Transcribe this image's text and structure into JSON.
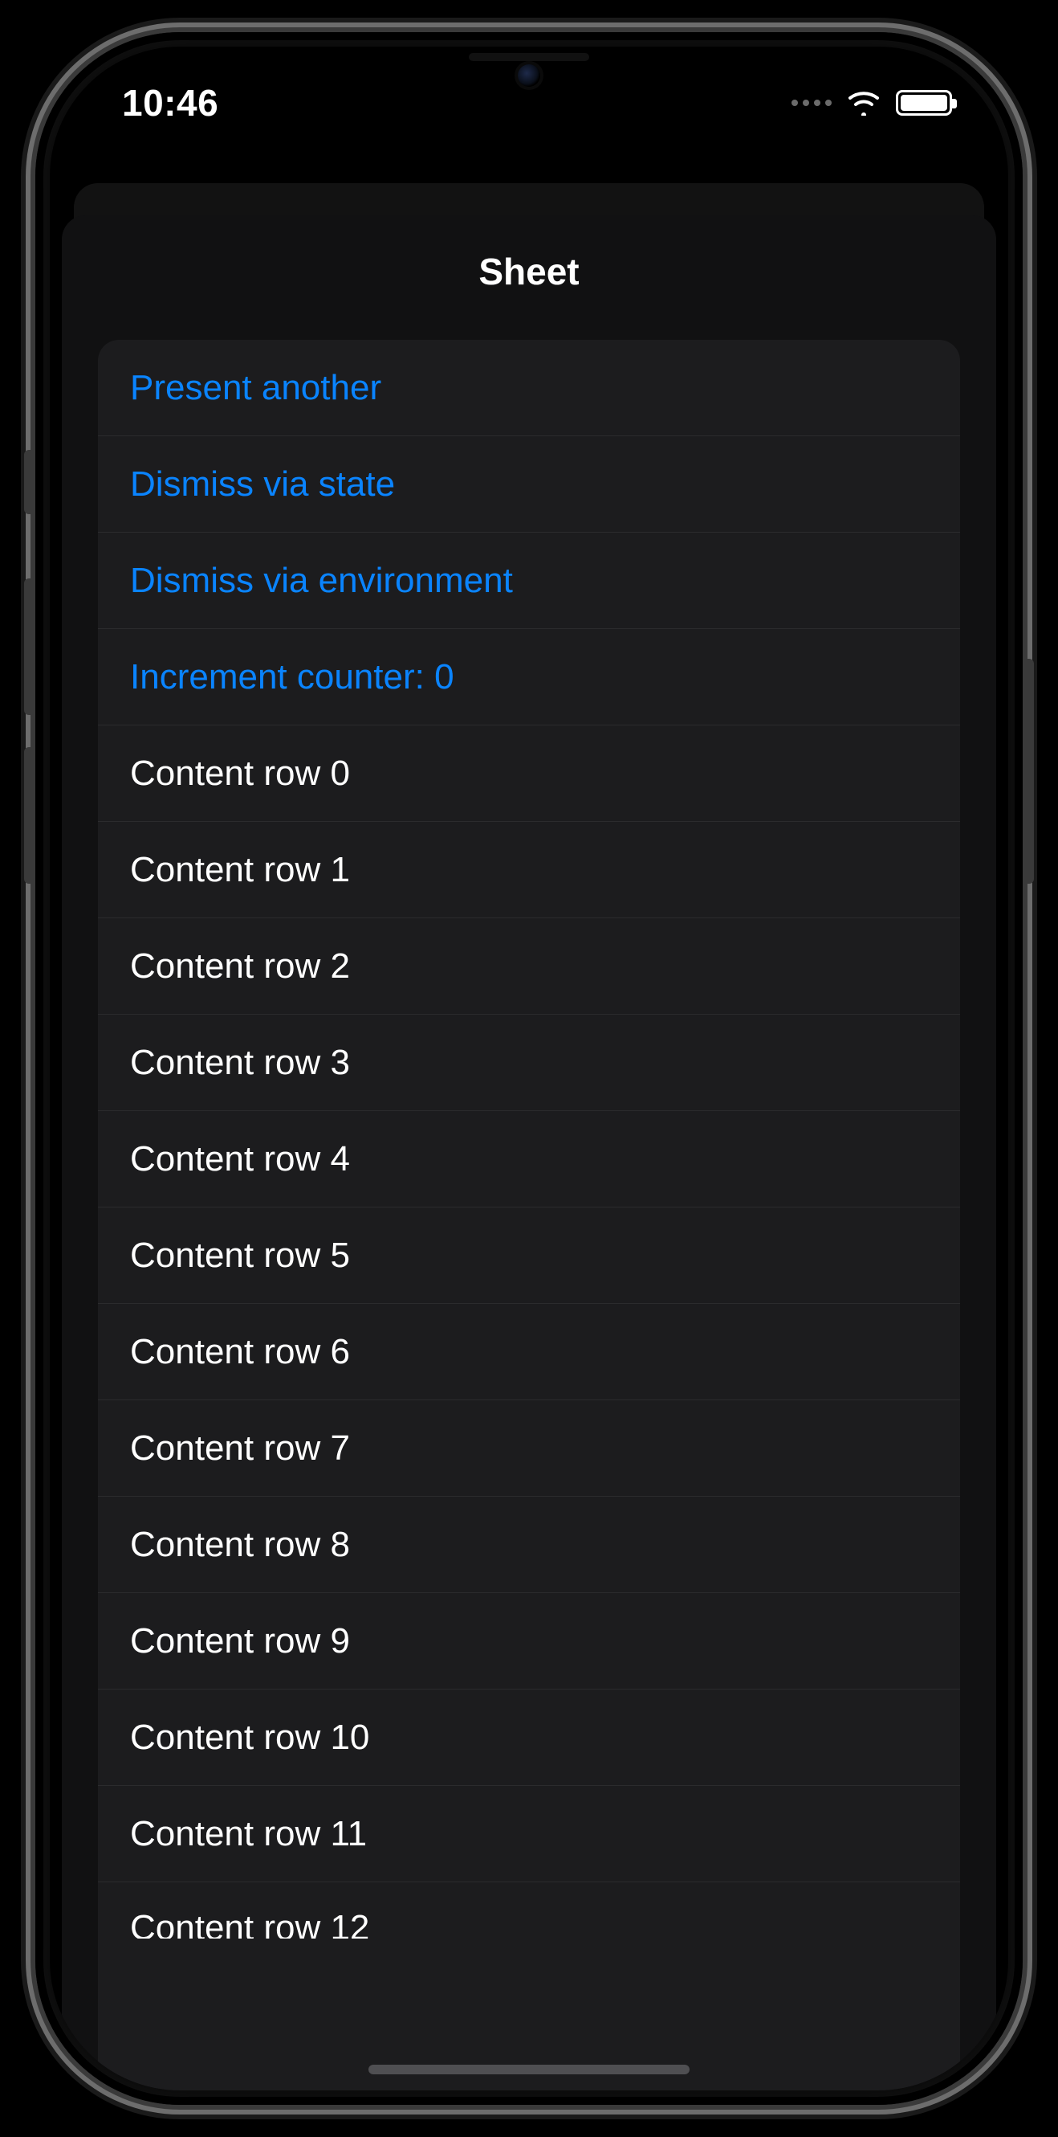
{
  "status": {
    "time": "10:46"
  },
  "sheet": {
    "title": "Sheet",
    "actions": {
      "present": "Present another",
      "dismiss_state": "Dismiss via state",
      "dismiss_env": "Dismiss via environment",
      "increment": "Increment counter: 0"
    },
    "rows": [
      "Content row 0",
      "Content row 1",
      "Content row 2",
      "Content row 3",
      "Content row 4",
      "Content row 5",
      "Content row 6",
      "Content row 7",
      "Content row 8",
      "Content row 9",
      "Content row 10",
      "Content row 11",
      "Content row 12"
    ]
  },
  "colors": {
    "accent": "#0a84ff",
    "bg": "#000000",
    "cell": "#1c1c1e"
  }
}
